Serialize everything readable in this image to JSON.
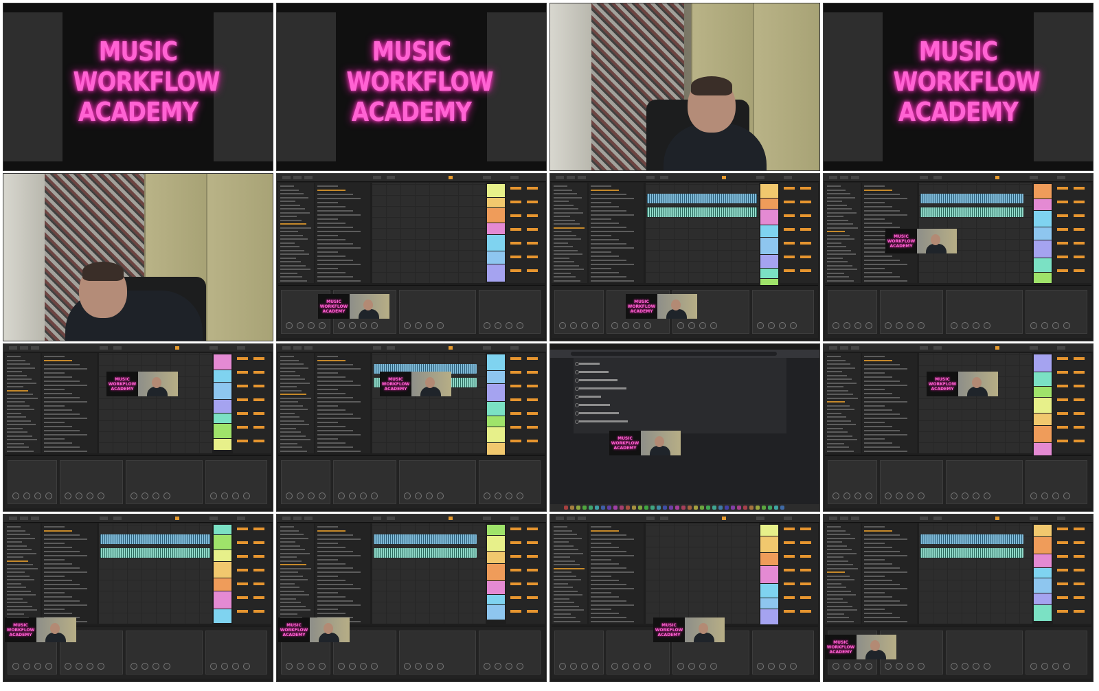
{
  "logo": {
    "line1": "MUSIC",
    "line2": "WORKFLOW",
    "line3": "ACADEMY"
  },
  "overlay_logo": {
    "line1": "MUSIC",
    "line2": "WORKFLOW",
    "line3": "ACADEMY"
  },
  "tiles": [
    {
      "kind": "logo"
    },
    {
      "kind": "logo"
    },
    {
      "kind": "webcam"
    },
    {
      "kind": "logo"
    },
    {
      "kind": "webcam"
    },
    {
      "kind": "daw"
    },
    {
      "kind": "daw"
    },
    {
      "kind": "daw"
    },
    {
      "kind": "daw"
    },
    {
      "kind": "daw"
    },
    {
      "kind": "browser"
    },
    {
      "kind": "daw"
    },
    {
      "kind": "daw"
    },
    {
      "kind": "daw"
    },
    {
      "kind": "daw"
    },
    {
      "kind": "daw"
    }
  ],
  "colors": {
    "logo_pink": "#ff63d3",
    "daw_accent": "#e69a2d",
    "clip_colors": [
      "#7fd3f0",
      "#8ec6ef",
      "#a5a3f0",
      "#7be1c4",
      "#9fe36a",
      "#e7f08a",
      "#f1c86e",
      "#ef9c5a",
      "#e48ad3"
    ]
  },
  "icons": [
    "folder-icon",
    "play-icon",
    "record-icon",
    "knob-icon",
    "search-icon"
  ]
}
